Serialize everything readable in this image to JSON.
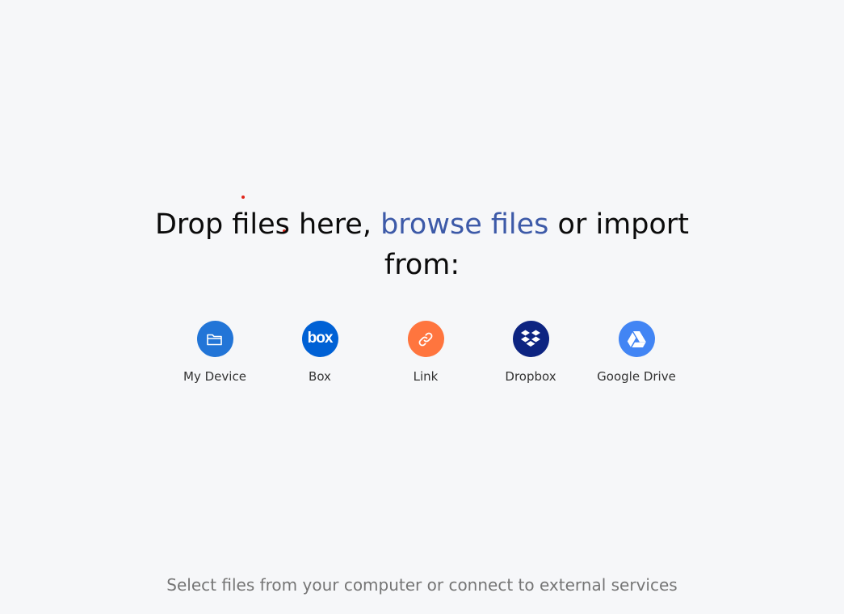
{
  "headline": {
    "part1": "Drop files here, ",
    "browse_link": "browse files",
    "part2": " or import",
    "line2": "from:"
  },
  "sources": [
    {
      "label": "My Device",
      "icon": "folder-icon",
      "color": "#2275d7"
    },
    {
      "label": "Box",
      "icon": "box-logo-icon",
      "color": "#0061d5",
      "logo_text": "box"
    },
    {
      "label": "Link",
      "icon": "link-icon",
      "color": "#ff753e"
    },
    {
      "label": "Dropbox",
      "icon": "dropbox-icon",
      "color": "#0d2481"
    },
    {
      "label": "Google Drive",
      "icon": "google-drive-icon",
      "color": "#4285f4"
    }
  ],
  "footer": "Select files from your computer or connect to external services",
  "colors": {
    "background": "#f6f7f9",
    "browse_link": "#3d5aa8",
    "footer_text": "#757575",
    "cursor_dot": "#e0261b"
  }
}
